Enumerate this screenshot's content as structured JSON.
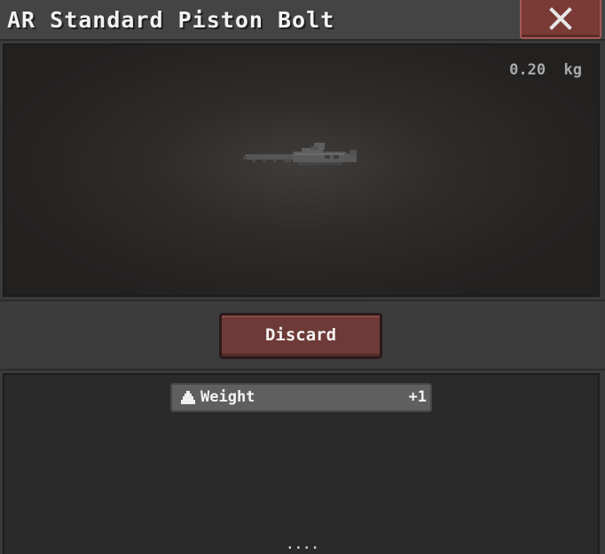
{
  "window": {
    "title": "AR Standard Piston Bolt",
    "close_icon": "close-x-icon"
  },
  "preview": {
    "weight_text": "0.20  kg",
    "item_icon": "piston-bolt-sprite"
  },
  "actions": {
    "discard_label": "Discard"
  },
  "stats": {
    "rows": [
      {
        "icon": "weight-icon",
        "name": "Weight",
        "value": "+1"
      }
    ],
    "more_indicator": "...."
  },
  "colors": {
    "close_button": "#7a3a36",
    "discard_button": "#6e3a37",
    "stat_row": "#5f5f5f",
    "panel_dark": "#2a2a2a"
  }
}
